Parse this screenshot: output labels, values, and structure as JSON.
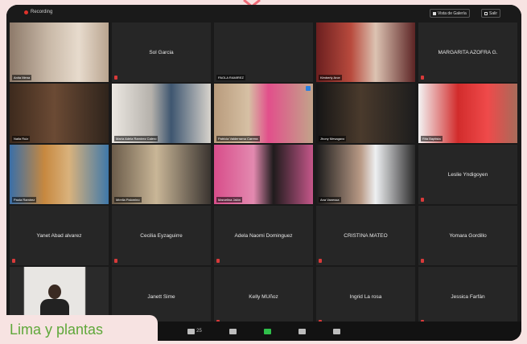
{
  "topbar": {
    "recording_label": "Recording",
    "view_button_label": "Vista de Galería",
    "exit_button_label": "Salir"
  },
  "tiles": [
    {
      "label": "Anita Mena",
      "center": "",
      "video": "person-dance-beige"
    },
    {
      "label": "",
      "center": "Sol Garcia",
      "video": ""
    },
    {
      "label": "PAOLA RAMIREZ",
      "center": "",
      "video": ""
    },
    {
      "label": "Kimberly Arce",
      "center": "",
      "video": "person-dance-red"
    },
    {
      "label": "",
      "center": "MARGARITA AZOFRA G.",
      "video": ""
    },
    {
      "label": "Naila Ruiz",
      "center": "",
      "video": "person-dance-brown"
    },
    {
      "label": "María Adela Ramírez Calero",
      "center": "",
      "video": "person-blue-shirt"
    },
    {
      "label": "Patricia Valderrama Carrera",
      "center": "",
      "video": "person-pink-shirt"
    },
    {
      "label": "Jhony Mesagavo",
      "center": "",
      "video": "person-dark-room"
    },
    {
      "label": "Rita Baptista",
      "center": "",
      "video": "person-red-banner"
    },
    {
      "label": "Paola Ramirez",
      "center": "",
      "video": "person-art-wall"
    },
    {
      "label": "Mirella Palomino",
      "center": "",
      "video": "person-cabinet"
    },
    {
      "label": "Marcelina Jalón",
      "center": "",
      "video": "person-pink-wall"
    },
    {
      "label": "Ana Vanessa",
      "center": "",
      "video": "person-mask"
    },
    {
      "label": "",
      "center": "Leslie Yndigoyen",
      "video": ""
    },
    {
      "label": "",
      "center": "Yanet Abad alvarez",
      "video": ""
    },
    {
      "label": "",
      "center": "Cecilia Eyzaguirre",
      "video": ""
    },
    {
      "label": "",
      "center": "Adela Naomi Dominguez",
      "video": ""
    },
    {
      "label": "",
      "center": "CRISTINA MATEO",
      "video": ""
    },
    {
      "label": "",
      "center": "Yomara Gordillo",
      "video": ""
    },
    {
      "label": "",
      "center": "",
      "video": "person-interpreter"
    },
    {
      "label": "",
      "center": "Janett Sime",
      "video": ""
    },
    {
      "label": "",
      "center": "Kelly MUñoz",
      "video": ""
    },
    {
      "label": "",
      "center": "Ingrid La rosa",
      "video": ""
    },
    {
      "label": "",
      "center": "Jessica Farfán",
      "video": ""
    }
  ],
  "toolbar": {
    "participants_count": "25"
  },
  "caption": {
    "text": "Lima y plantas"
  },
  "colors": {
    "background": "#f7e3e2",
    "caption_text": "#5fa83a",
    "frame": "#1a1a1a",
    "tile": "#262626",
    "active_border": "#a7d86a",
    "recording_dot": "#e0322b"
  }
}
